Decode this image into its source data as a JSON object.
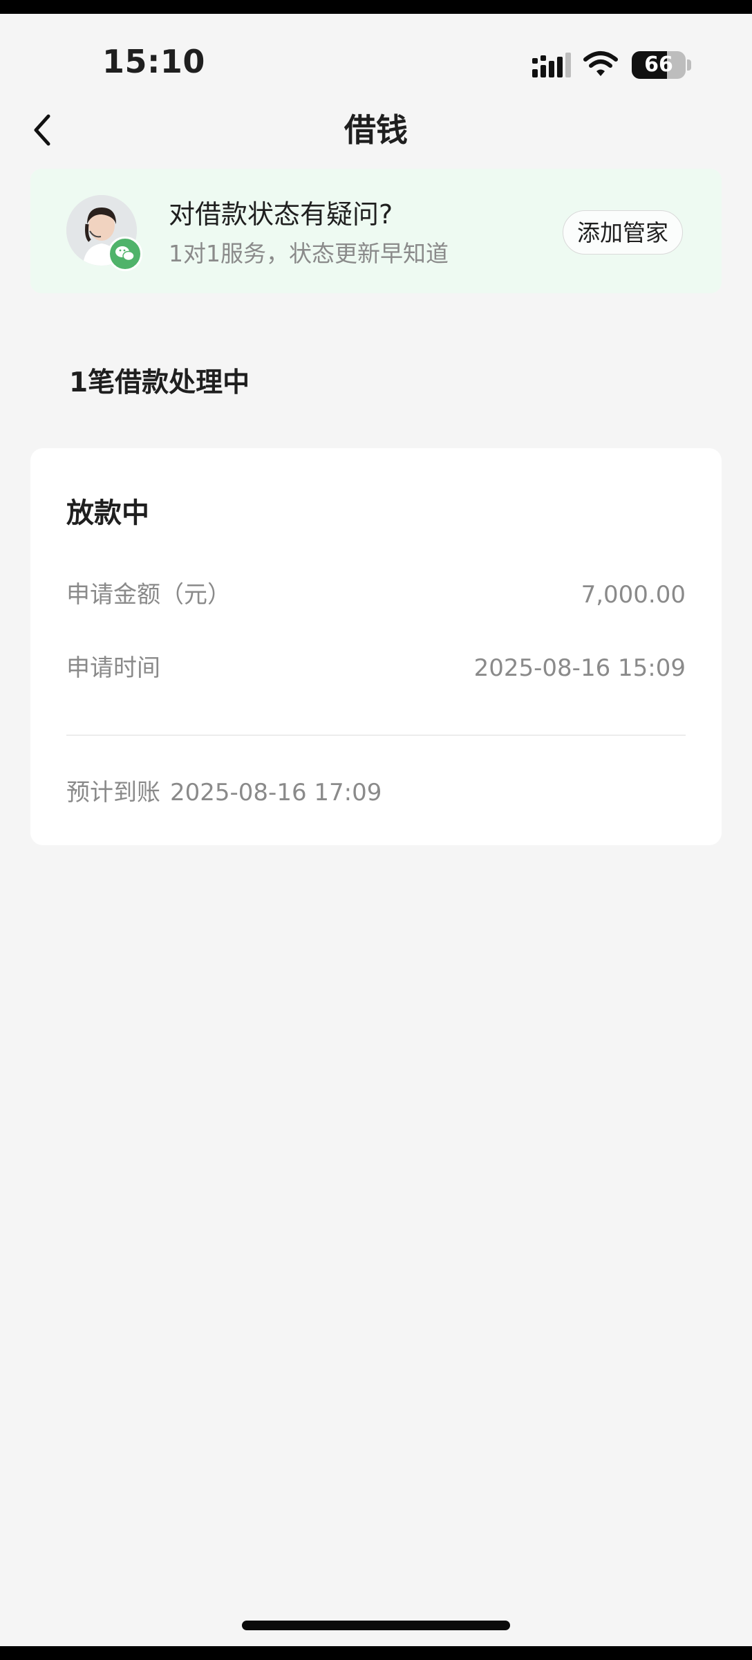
{
  "status_bar": {
    "time": "15:10",
    "battery": "66",
    "battery_level": 0.66
  },
  "nav": {
    "title": "借钱"
  },
  "service_banner": {
    "title": "对借款状态有疑问?",
    "subtitle": "1对1服务，状态更新早知道",
    "button_label": "添加管家"
  },
  "section": {
    "title": "1笔借款处理中"
  },
  "loan": {
    "status": "放款中",
    "amount_label": "申请金额（元）",
    "amount_value": "7,000.00",
    "time_label": "申请时间",
    "time_value": "2025-08-16 15:09",
    "expected_label": "预计到账",
    "expected_value": "2025-08-16 17:09"
  },
  "colors": {
    "banner_bg": "#eefaf2",
    "wechat_green": "#4fb36a",
    "page_bg": "#f5f5f5",
    "muted_text": "#8a8a8a"
  }
}
